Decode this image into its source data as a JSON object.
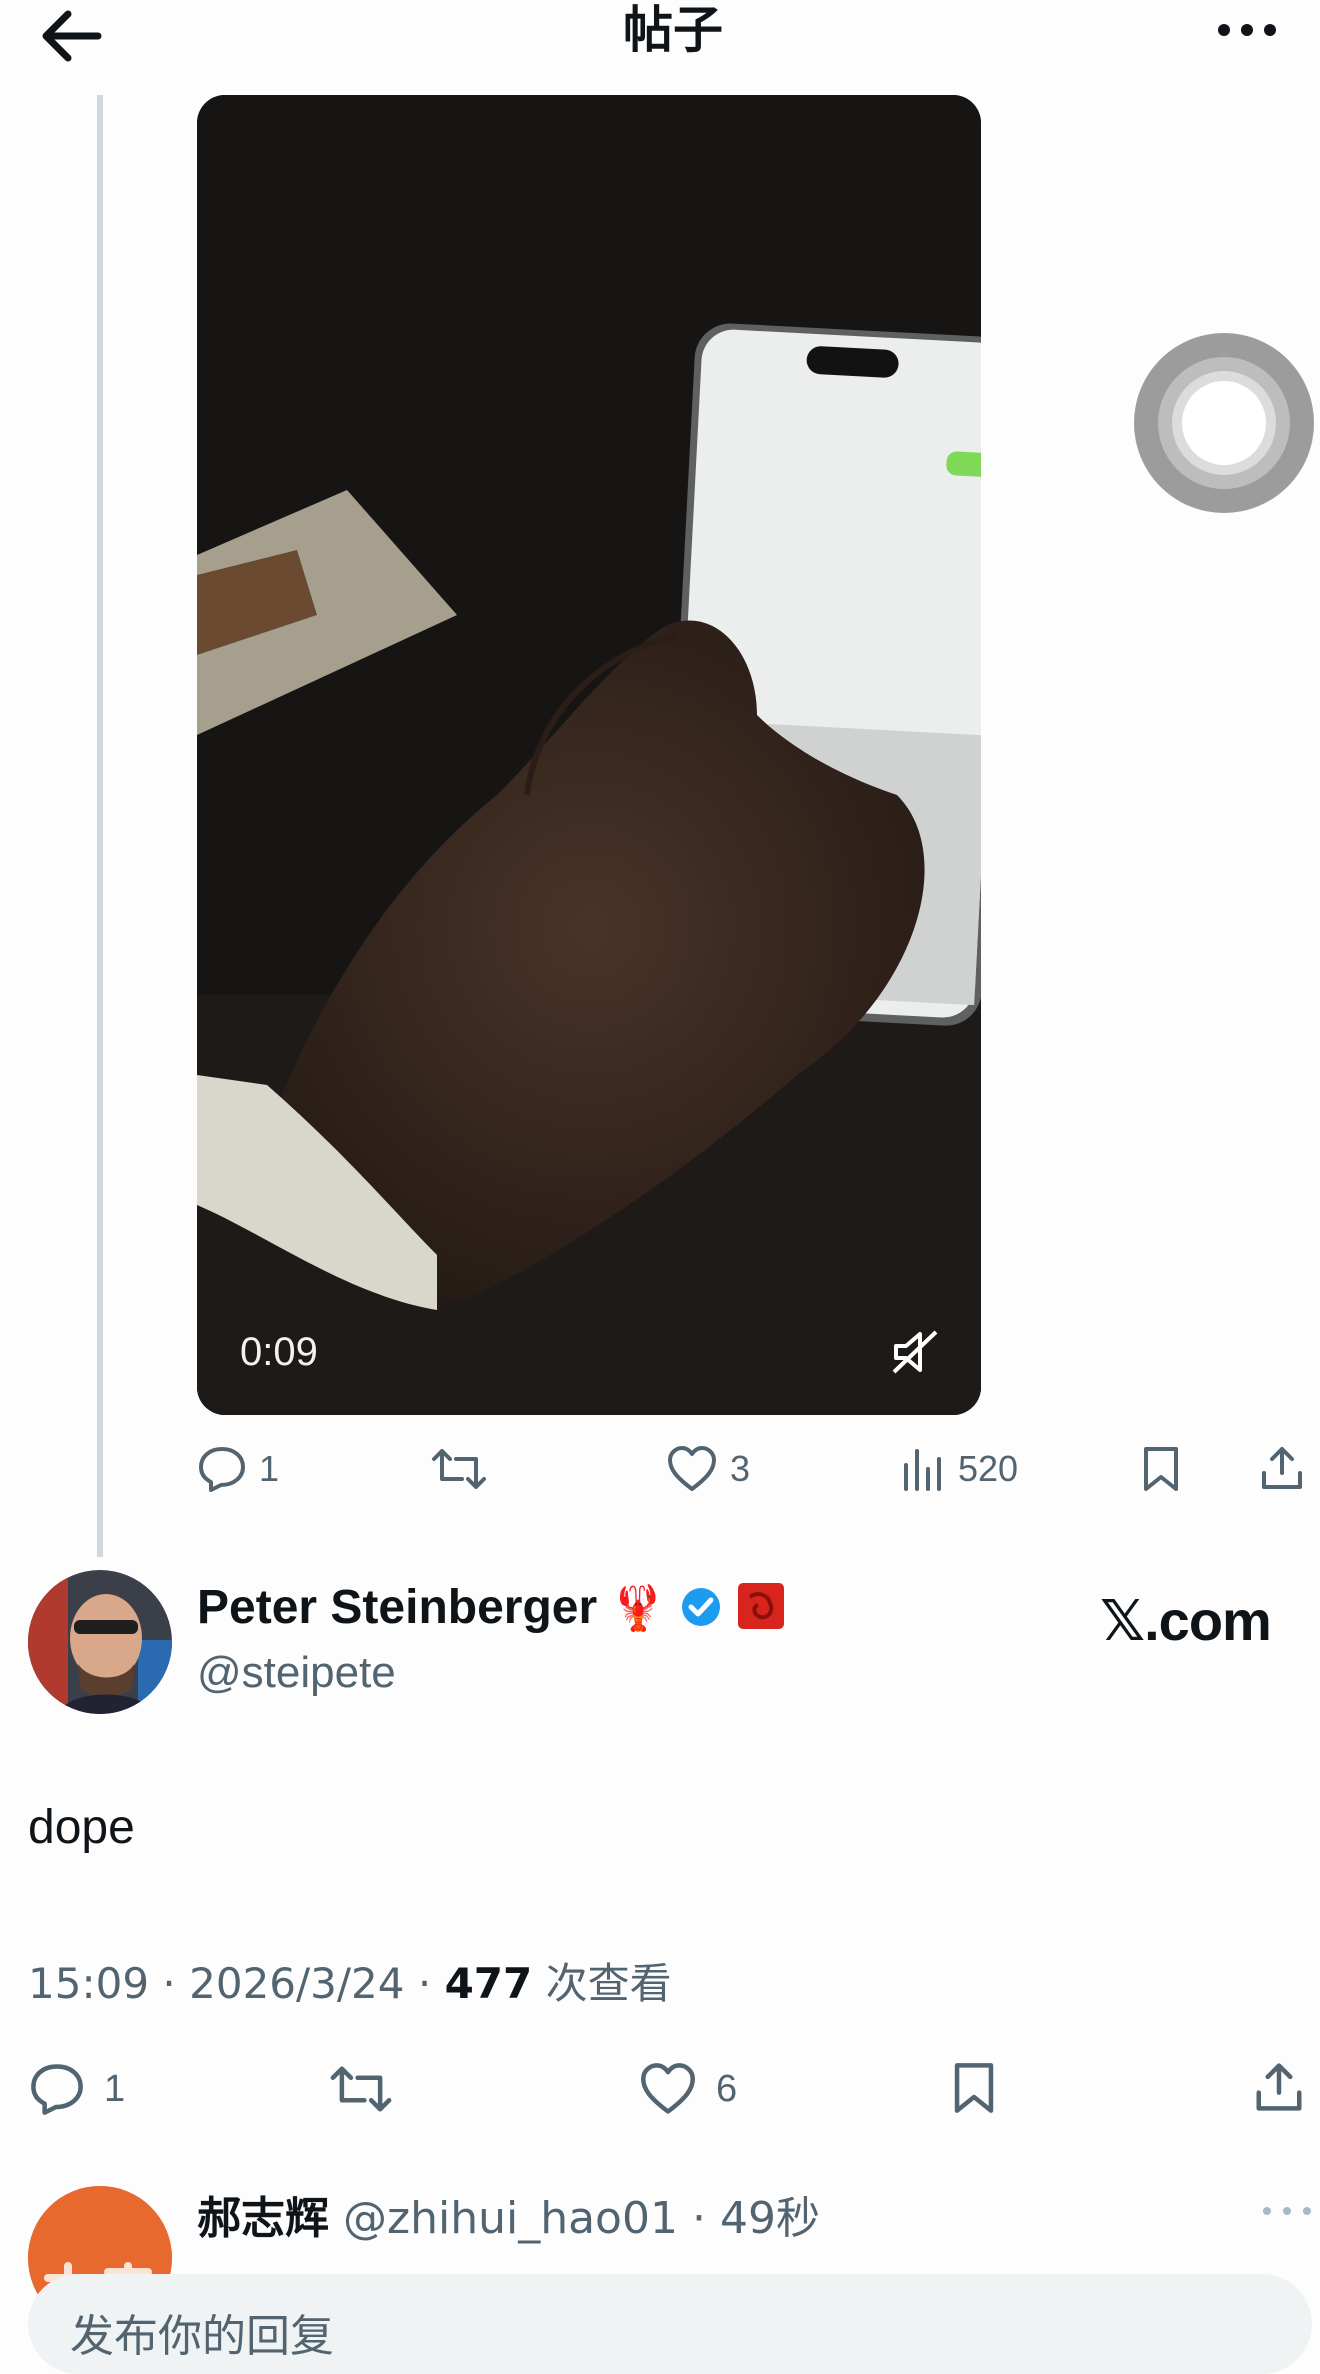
{
  "header": {
    "title": "帖子"
  },
  "video": {
    "time": "0:09"
  },
  "video_actions": {
    "replies": "1",
    "likes": "3",
    "views": "520"
  },
  "author": {
    "name": "Peter Steinberger",
    "emoji": "🦞",
    "handle": "@steipete",
    "watermark": "𝕏.com"
  },
  "post": {
    "text": "dope",
    "time": "15:09",
    "date": "2026/3/24",
    "views_count": "477",
    "views_label": "次查看"
  },
  "post_actions": {
    "replies": "1",
    "likes": "6"
  },
  "reply": {
    "name": "郝志辉",
    "handle": "@zhihui_hao01",
    "age": "49秒",
    "placeholder": "发布你的回复"
  },
  "icons": {
    "back": "arrow-left-icon",
    "more": "more-horizontal-icon",
    "reply": "speech-bubble-icon",
    "repost": "repost-icon",
    "like": "heart-icon",
    "views": "bar-chart-icon",
    "bookmark": "bookmark-icon",
    "share": "share-icon",
    "mute": "muted-speaker-icon",
    "verified": "verified-badge-icon"
  },
  "colors": {
    "text": "#0f1419",
    "muted": "#536471",
    "verified": "#1d9bf0",
    "line": "#cfd9de"
  }
}
